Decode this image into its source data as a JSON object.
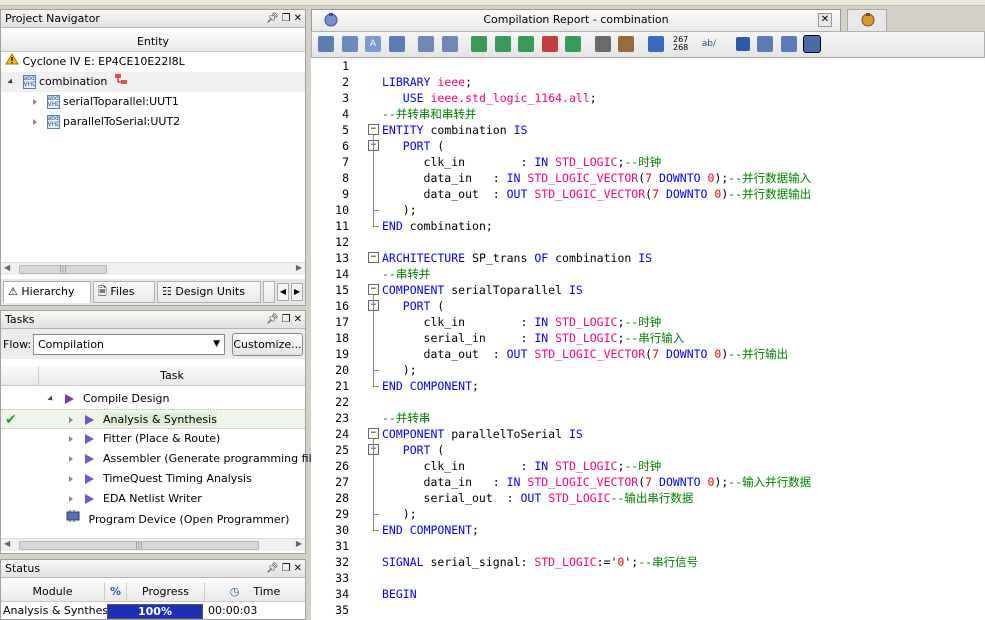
{
  "project_navigator": {
    "title": "Project Navigator",
    "column": "Entity",
    "device": "Cyclone IV E: EP4CE10E22I8L",
    "top": "combination",
    "children": [
      "serialToparallel:UUT1",
      "parallelToSerial:UUT2"
    ],
    "tabs": [
      "Hierarchy",
      "Files",
      "Design Units"
    ]
  },
  "tasks": {
    "title": "Tasks",
    "flow_label": "Flow:",
    "flow_value": "Compilation",
    "customize": "Customize...",
    "column": "Task",
    "items": [
      {
        "label": "Compile Design",
        "status": ""
      },
      {
        "label": "Analysis & Synthesis",
        "status": "done"
      },
      {
        "label": "Fitter (Place & Route)",
        "status": ""
      },
      {
        "label": "Assembler (Generate programming files)",
        "status": ""
      },
      {
        "label": "TimeQuest Timing Analysis",
        "status": ""
      },
      {
        "label": "EDA Netlist Writer",
        "status": ""
      },
      {
        "label": "Program Device (Open Programmer)",
        "status": ""
      }
    ]
  },
  "status_panel": {
    "title": "Status",
    "columns": [
      "Module",
      "%",
      "Progress",
      "Time"
    ],
    "row": {
      "module": "Analysis & Synthesis",
      "progress": "100%",
      "progress_fraction": 1.0,
      "time": "00:00:03"
    }
  },
  "editor": {
    "tab_title": "Compilation Report - combination",
    "toolbar_num_top": "267",
    "toolbar_num_bottom": "268",
    "toolbar_ab": "ab/"
  },
  "code": [
    [],
    [
      [
        "kw",
        "LIBRARY"
      ],
      [
        "id",
        " "
      ],
      [
        "ty",
        "ieee"
      ],
      [
        "id",
        ";"
      ]
    ],
    [
      [
        "id",
        "   "
      ],
      [
        "kw",
        "USE"
      ],
      [
        "id",
        " "
      ],
      [
        "ty",
        "ieee.std_logic_1164.all"
      ],
      [
        "id",
        ";"
      ]
    ],
    [
      [
        "cm",
        "--并转串和串转并"
      ]
    ],
    [
      [
        "kw",
        "ENTITY"
      ],
      [
        "id",
        " combination "
      ],
      [
        "kw",
        "IS"
      ]
    ],
    [
      [
        "id",
        "   "
      ],
      [
        "kw",
        "PORT"
      ],
      [
        "id",
        " ("
      ]
    ],
    [
      [
        "id",
        "      clk_in        : "
      ],
      [
        "kw",
        "IN"
      ],
      [
        "id",
        " "
      ],
      [
        "ty",
        "STD_LOGIC"
      ],
      [
        "id",
        ";"
      ],
      [
        "cm",
        "--时钟"
      ]
    ],
    [
      [
        "id",
        "      data_in   : "
      ],
      [
        "kw",
        "IN"
      ],
      [
        "id",
        " "
      ],
      [
        "ty",
        "STD_LOGIC_VECTOR"
      ],
      [
        "id",
        "("
      ],
      [
        "nm",
        "7"
      ],
      [
        "id",
        " "
      ],
      [
        "kw",
        "DOWNTO"
      ],
      [
        "id",
        " "
      ],
      [
        "nm",
        "0"
      ],
      [
        "id",
        ");"
      ],
      [
        "cm",
        "--并行数据输入"
      ]
    ],
    [
      [
        "id",
        "      data_out  : "
      ],
      [
        "kw",
        "OUT"
      ],
      [
        "id",
        " "
      ],
      [
        "ty",
        "STD_LOGIC_VECTOR"
      ],
      [
        "id",
        "("
      ],
      [
        "nm",
        "7"
      ],
      [
        "id",
        " "
      ],
      [
        "kw",
        "DOWNTO"
      ],
      [
        "id",
        " "
      ],
      [
        "nm",
        "0"
      ],
      [
        "id",
        ")"
      ],
      [
        "cm",
        "--并行数据输出"
      ]
    ],
    [
      [
        "id",
        "   );"
      ]
    ],
    [
      [
        "kw",
        "END"
      ],
      [
        "id",
        " combination;"
      ]
    ],
    [],
    [
      [
        "kw",
        "ARCHITECTURE"
      ],
      [
        "id",
        " SP_trans "
      ],
      [
        "kw",
        "OF"
      ],
      [
        "id",
        " combination "
      ],
      [
        "kw",
        "IS"
      ]
    ],
    [
      [
        "cm",
        "--串转并"
      ]
    ],
    [
      [
        "kw",
        "COMPONENT"
      ],
      [
        "id",
        " serialToparallel "
      ],
      [
        "kw",
        "IS"
      ]
    ],
    [
      [
        "id",
        "   "
      ],
      [
        "kw",
        "PORT"
      ],
      [
        "id",
        " ("
      ]
    ],
    [
      [
        "id",
        "      clk_in        : "
      ],
      [
        "kw",
        "IN"
      ],
      [
        "id",
        " "
      ],
      [
        "ty",
        "STD_LOGIC"
      ],
      [
        "id",
        ";"
      ],
      [
        "cm",
        "--时钟"
      ]
    ],
    [
      [
        "id",
        "      serial_in     : "
      ],
      [
        "kw",
        "IN"
      ],
      [
        "id",
        " "
      ],
      [
        "ty",
        "STD_LOGIC"
      ],
      [
        "id",
        ";"
      ],
      [
        "cm",
        "--串行输入"
      ]
    ],
    [
      [
        "id",
        "      data_out  : "
      ],
      [
        "kw",
        "OUT"
      ],
      [
        "id",
        " "
      ],
      [
        "ty",
        "STD_LOGIC_VECTOR"
      ],
      [
        "id",
        "("
      ],
      [
        "nm",
        "7"
      ],
      [
        "id",
        " "
      ],
      [
        "kw",
        "DOWNTO"
      ],
      [
        "id",
        " "
      ],
      [
        "nm",
        "0"
      ],
      [
        "id",
        ")"
      ],
      [
        "cm",
        "--并行输出"
      ]
    ],
    [
      [
        "id",
        "   );"
      ]
    ],
    [
      [
        "kw",
        "END"
      ],
      [
        "id",
        " "
      ],
      [
        "kw",
        "COMPONENT"
      ],
      [
        "id",
        ";"
      ]
    ],
    [],
    [
      [
        "cm",
        "--并转串"
      ]
    ],
    [
      [
        "kw",
        "COMPONENT"
      ],
      [
        "id",
        " parallelToSerial "
      ],
      [
        "kw",
        "IS"
      ]
    ],
    [
      [
        "id",
        "   "
      ],
      [
        "kw",
        "PORT"
      ],
      [
        "id",
        " ("
      ]
    ],
    [
      [
        "id",
        "      clk_in        : "
      ],
      [
        "kw",
        "IN"
      ],
      [
        "id",
        " "
      ],
      [
        "ty",
        "STD_LOGIC"
      ],
      [
        "id",
        ";"
      ],
      [
        "cm",
        "--时钟"
      ]
    ],
    [
      [
        "id",
        "      data_in   : "
      ],
      [
        "kw",
        "IN"
      ],
      [
        "id",
        " "
      ],
      [
        "ty",
        "STD_LOGIC_VECTOR"
      ],
      [
        "id",
        "("
      ],
      [
        "nm",
        "7"
      ],
      [
        "id",
        " "
      ],
      [
        "kw",
        "DOWNTO"
      ],
      [
        "id",
        " "
      ],
      [
        "nm",
        "0"
      ],
      [
        "id",
        ");"
      ],
      [
        "cm",
        "--输入并行数据"
      ]
    ],
    [
      [
        "id",
        "      serial_out  : "
      ],
      [
        "kw",
        "OUT"
      ],
      [
        "id",
        " "
      ],
      [
        "ty",
        "STD_LOGIC"
      ],
      [
        "cm",
        "--输出串行数据"
      ]
    ],
    [
      [
        "id",
        "   );"
      ]
    ],
    [
      [
        "kw",
        "END"
      ],
      [
        "id",
        " "
      ],
      [
        "kw",
        "COMPONENT"
      ],
      [
        "id",
        ";"
      ]
    ],
    [],
    [
      [
        "kw",
        "SIGNAL"
      ],
      [
        "id",
        " serial_signal: "
      ],
      [
        "ty",
        "STD_LOGIC"
      ],
      [
        "id",
        ":='"
      ],
      [
        "nm",
        "0"
      ],
      [
        "id",
        "';"
      ],
      [
        "cm",
        "--串行信号"
      ]
    ],
    [],
    [
      [
        "kw",
        "BEGIN"
      ]
    ],
    []
  ],
  "colors": {
    "keyword": "#0000ff",
    "type": "#ff0080",
    "comment": "#008000",
    "number": "#ff0000",
    "progress": "#1c2fb8"
  }
}
